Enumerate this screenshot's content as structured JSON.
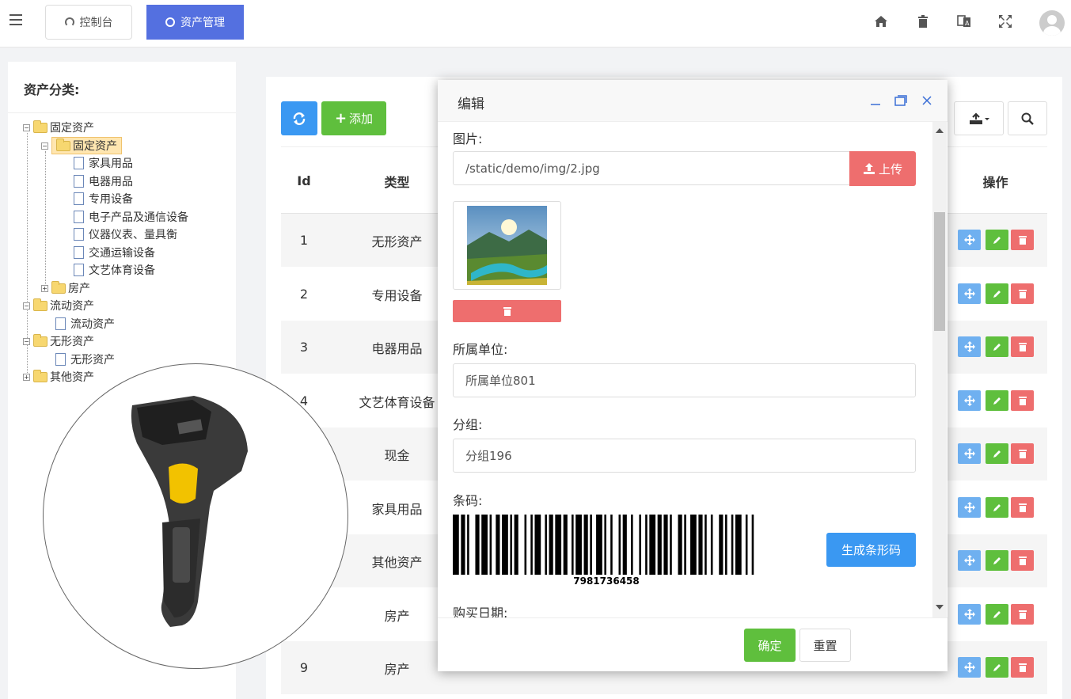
{
  "topbar": {
    "tabs": [
      {
        "label": "控制台",
        "icon": "dashboard-icon"
      },
      {
        "label": "资产管理",
        "icon": "circle-icon"
      }
    ],
    "icons": [
      "home-icon",
      "trash-icon",
      "translate-icon",
      "fullscreen-icon",
      "avatar"
    ]
  },
  "sidebar": {
    "title": "资产分类:",
    "tree": {
      "fixed_root": "固定资产",
      "fixed_sub": "固定资产",
      "items": [
        "家具用品",
        "电器用品",
        "专用设备",
        "电子产品及通信设备",
        "仪器仪表、量具衡",
        "交通运输设备",
        "文艺体育设备"
      ],
      "house": "房产",
      "current_root": "流动资产",
      "current_child": "流动资产",
      "intangible_root": "无形资产",
      "intangible_child": "无形资产",
      "other_root": "其他资产"
    }
  },
  "toolbar": {
    "add_label": "添加"
  },
  "table": {
    "headers": {
      "id": "Id",
      "type": "类型",
      "action": "操作"
    },
    "rows": [
      {
        "id": "1",
        "type": "无形资产"
      },
      {
        "id": "2",
        "type": "专用设备"
      },
      {
        "id": "3",
        "type": "电器用品"
      },
      {
        "id": "4",
        "type": "文艺体育设备"
      },
      {
        "id": "",
        "type": "现金"
      },
      {
        "id": "",
        "type": "家具用品"
      },
      {
        "id": "",
        "type": "其他资产"
      },
      {
        "id": "",
        "type": "房产"
      },
      {
        "id": "9",
        "type": "房产"
      }
    ]
  },
  "modal": {
    "title": "编辑",
    "image_label": "图片:",
    "image_path": "/static/demo/img/2.jpg",
    "upload_label": "上传",
    "unit_label": "所属单位:",
    "unit_value": "所属单位801",
    "group_label": "分组:",
    "group_value": "分组196",
    "barcode_label": "条码:",
    "barcode_number": "7981736458",
    "generate_label": "生成条形码",
    "purchase_label": "购买日期:",
    "ok_label": "确定",
    "reset_label": "重置"
  },
  "colors": {
    "primary_blue": "#5470e0",
    "refresh_blue": "#3a98f2",
    "green": "#5fbf3d",
    "red": "#ee6e6e"
  }
}
